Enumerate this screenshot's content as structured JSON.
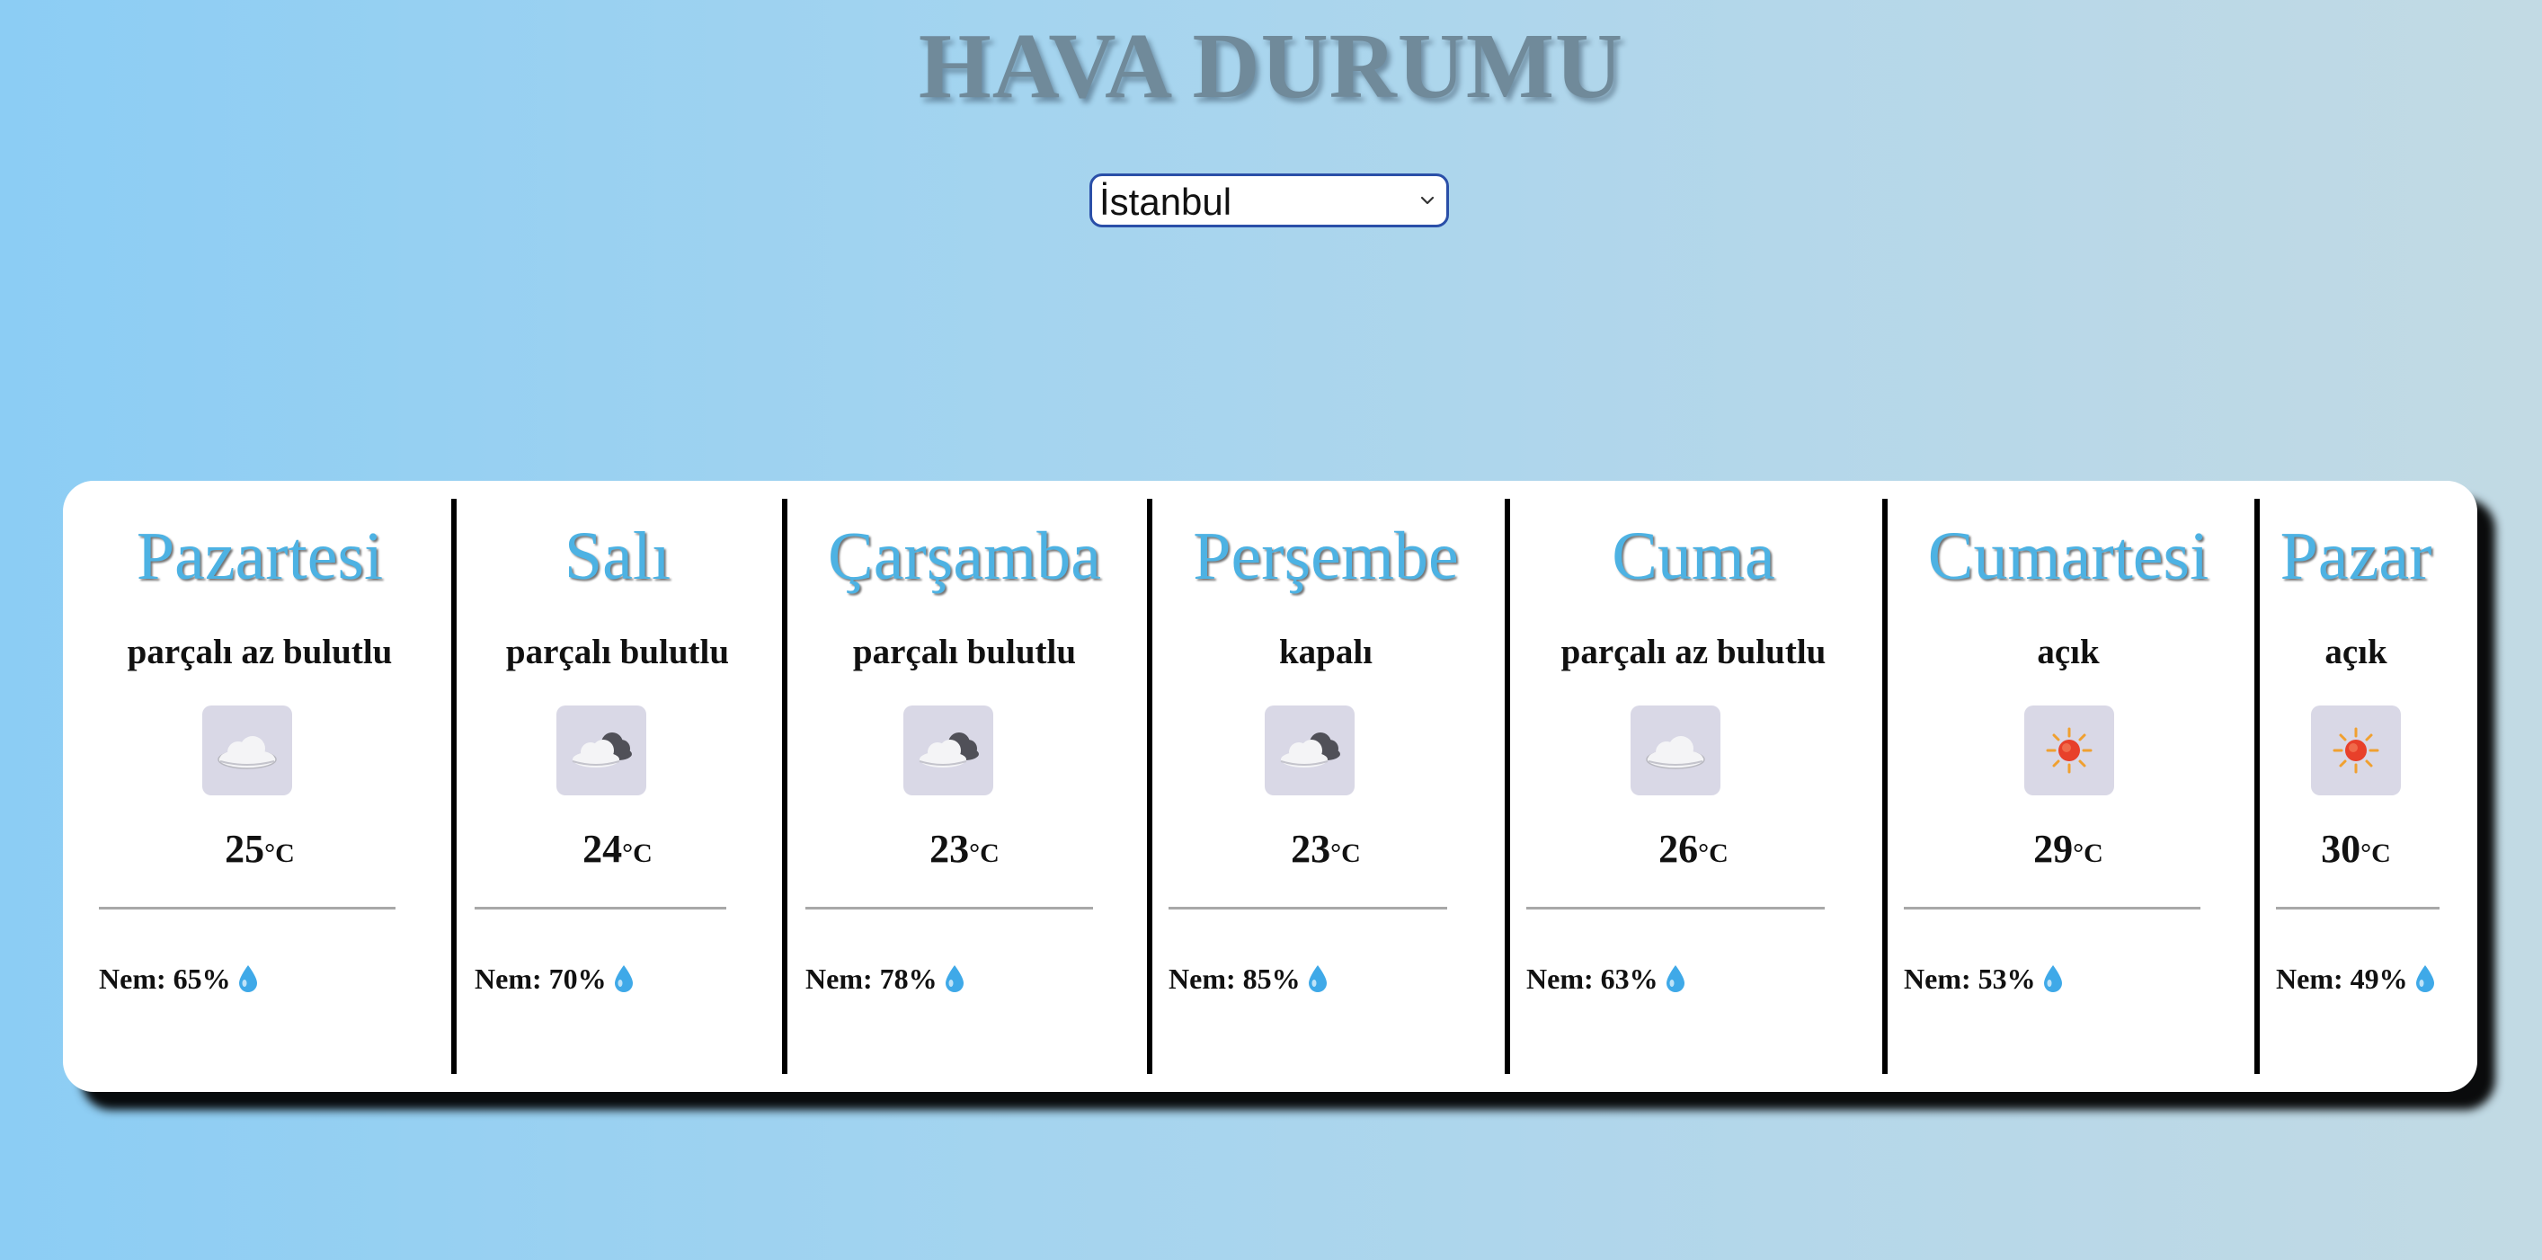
{
  "header": {
    "title": "HAVA DURUMU"
  },
  "city_select": {
    "selected": "İstanbul",
    "icon": "chevron-down-icon"
  },
  "colors": {
    "day_name": "#4db2e3",
    "title": "#708a9a",
    "icon_bg": "#d9d8e6",
    "drop": "#3fa9e8"
  },
  "days": [
    {
      "name": "Pazartesi",
      "desc": "parçalı az bulutlu",
      "icon": "cloud-icon",
      "temp": "25",
      "unit": "°C",
      "humidity": "Nem: 65%"
    },
    {
      "name": "Salı",
      "desc": "parçalı bulutlu",
      "icon": "cloud-dark-icon",
      "temp": "24",
      "unit": "°C",
      "humidity": "Nem: 70%"
    },
    {
      "name": "Çarşamba",
      "desc": "parçalı bulutlu",
      "icon": "cloud-dark-icon",
      "temp": "23",
      "unit": "°C",
      "humidity": "Nem: 78%"
    },
    {
      "name": "Perşembe",
      "desc": "kapalı",
      "icon": "cloud-dark-icon",
      "temp": "23",
      "unit": "°C",
      "humidity": "Nem: 85%"
    },
    {
      "name": "Cuma",
      "desc": "parçalı az bulutlu",
      "icon": "cloud-icon",
      "temp": "26",
      "unit": "°C",
      "humidity": "Nem: 63%"
    },
    {
      "name": "Cumartesi",
      "desc": "açık",
      "icon": "sun-icon",
      "temp": "29",
      "unit": "°C",
      "humidity": "Nem: 53%"
    },
    {
      "name": "Pazar",
      "desc": "açık",
      "icon": "sun-icon",
      "temp": "30",
      "unit": "°C",
      "humidity": "Nem: 49%"
    }
  ]
}
